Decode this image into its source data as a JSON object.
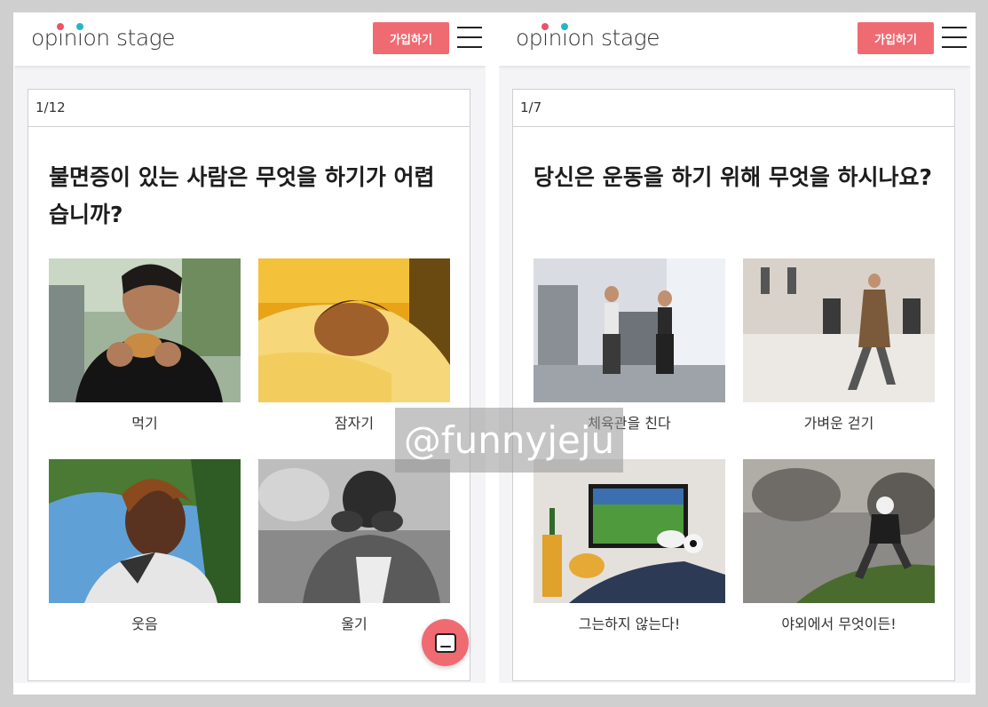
{
  "brand": {
    "logo_text": "opinion stage",
    "accent_colors": [
      "#e8546c",
      "#28b4c8"
    ],
    "primary_color": "#f06a72"
  },
  "panels": [
    {
      "signup_label": "가입하기",
      "counter": "1/12",
      "question": "불면증이 있는 사람은 무엇을 하기가 어렵습니까?",
      "options": [
        {
          "label": "먹기",
          "image": "man-eating-burger"
        },
        {
          "label": "잠자기",
          "image": "person-sleeping-on-pillow"
        },
        {
          "label": "웃음",
          "image": "woman-laughing"
        },
        {
          "label": "울기",
          "image": "man-crying-bw"
        }
      ]
    },
    {
      "signup_label": "가입하기",
      "counter": "1/7",
      "question": "당신은 운동을 하기 위해 무엇을 하시나요?",
      "options": [
        {
          "label": "체육관을 친다",
          "image": "gym-workout"
        },
        {
          "label": "가벼운 걷기",
          "image": "man-walking"
        },
        {
          "label": "그는하지 않는다!",
          "image": "feet-on-table-watching-tv"
        },
        {
          "label": "야외에서 무엇이든!",
          "image": "rock-climbing"
        }
      ]
    }
  ],
  "chat_icon": "chat-icon",
  "watermark": "@funnyjeju"
}
